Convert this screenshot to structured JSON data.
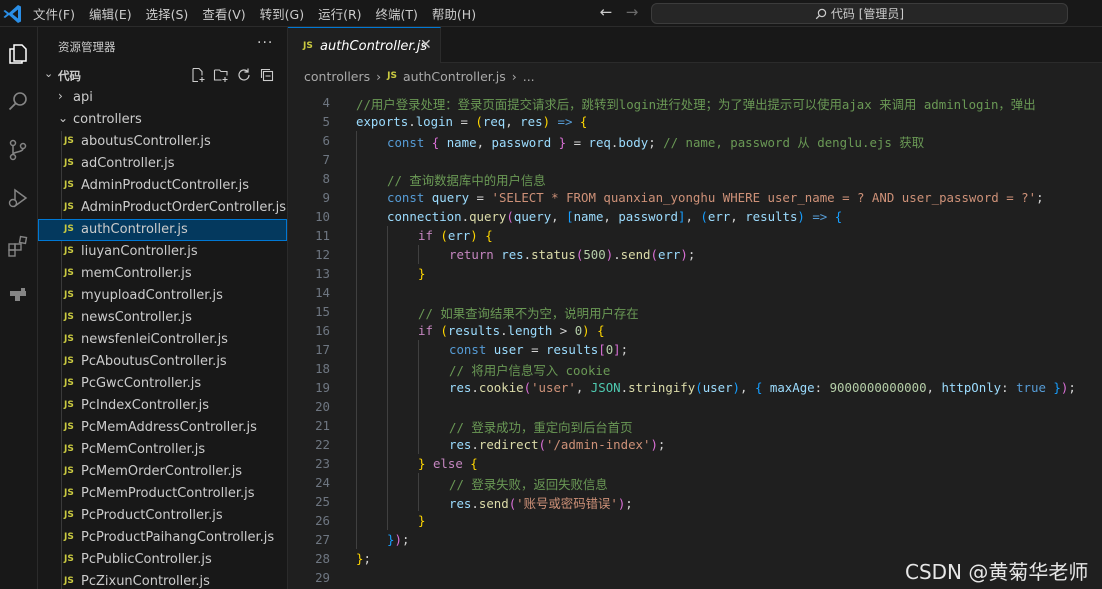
{
  "menu": [
    "文件(F)",
    "编辑(E)",
    "选择(S)",
    "查看(V)",
    "转到(G)",
    "运行(R)",
    "终端(T)",
    "帮助(H)"
  ],
  "search_label": "代码 [管理员]",
  "explorer": {
    "title": "资源管理器",
    "more": "···",
    "root": "代码",
    "items": [
      {
        "label": "api",
        "type": "folder",
        "expanded": false,
        "depth": 1
      },
      {
        "label": "controllers",
        "type": "folder",
        "expanded": true,
        "depth": 1
      },
      {
        "label": "aboutusController.js",
        "type": "js",
        "depth": 2
      },
      {
        "label": "adController.js",
        "type": "js",
        "depth": 2
      },
      {
        "label": "AdminProductController.js",
        "type": "js",
        "depth": 2
      },
      {
        "label": "AdminProductOrderController.js",
        "type": "js",
        "depth": 2
      },
      {
        "label": "authController.js",
        "type": "js",
        "depth": 2,
        "selected": true
      },
      {
        "label": "liuyanController.js",
        "type": "js",
        "depth": 2
      },
      {
        "label": "memController.js",
        "type": "js",
        "depth": 2
      },
      {
        "label": "myuploadController.js",
        "type": "js",
        "depth": 2
      },
      {
        "label": "newsController.js",
        "type": "js",
        "depth": 2
      },
      {
        "label": "newsfenleiController.js",
        "type": "js",
        "depth": 2
      },
      {
        "label": "PcAboutusController.js",
        "type": "js",
        "depth": 2
      },
      {
        "label": "PcGwcController.js",
        "type": "js",
        "depth": 2
      },
      {
        "label": "PcIndexController.js",
        "type": "js",
        "depth": 2
      },
      {
        "label": "PcMemAddressController.js",
        "type": "js",
        "depth": 2
      },
      {
        "label": "PcMemController.js",
        "type": "js",
        "depth": 2
      },
      {
        "label": "PcMemOrderController.js",
        "type": "js",
        "depth": 2
      },
      {
        "label": "PcMemProductController.js",
        "type": "js",
        "depth": 2
      },
      {
        "label": "PcProductController.js",
        "type": "js",
        "depth": 2
      },
      {
        "label": "PcProductPaihangController.js",
        "type": "js",
        "depth": 2
      },
      {
        "label": "PcPublicController.js",
        "type": "js",
        "depth": 2
      },
      {
        "label": "PcZixunController.js",
        "type": "js",
        "depth": 2
      }
    ]
  },
  "tab": {
    "label": "authController.js",
    "icon": "JS"
  },
  "breadcrumb": [
    "controllers",
    "authController.js",
    "..."
  ],
  "code": [
    {
      "n": "4",
      "indent": 0,
      "t": [
        [
          "c",
          "//用户登录处理：登录页面提交请求后，跳转到login进行处理；为了弹出提示可以使用ajax 来调用 adminlogin，弹出"
        ]
      ]
    },
    {
      "n": "5",
      "indent": 0,
      "t": [
        [
          "v",
          "exports"
        ],
        [
          "p",
          "."
        ],
        [
          "v",
          "login"
        ],
        [
          "p",
          " = "
        ],
        [
          "b1",
          "("
        ],
        [
          "v",
          "req"
        ],
        [
          "p",
          ", "
        ],
        [
          "v",
          "res"
        ],
        [
          "b1",
          ")"
        ],
        [
          "p",
          " "
        ],
        [
          "k",
          "=>"
        ],
        [
          "p",
          " "
        ],
        [
          "b1",
          "{"
        ]
      ]
    },
    {
      "n": "6",
      "indent": 1,
      "t": [
        [
          "k",
          "const"
        ],
        [
          "p",
          " "
        ],
        [
          "b2",
          "{"
        ],
        [
          "p",
          " "
        ],
        [
          "v",
          "name"
        ],
        [
          "p",
          ", "
        ],
        [
          "v",
          "password"
        ],
        [
          "p",
          " "
        ],
        [
          "b2",
          "}"
        ],
        [
          "p",
          " = "
        ],
        [
          "v",
          "req"
        ],
        [
          "p",
          "."
        ],
        [
          "v",
          "body"
        ],
        [
          "p",
          "; "
        ],
        [
          "c",
          "// name, password 从 denglu.ejs 获取"
        ]
      ]
    },
    {
      "n": "7",
      "indent": 1,
      "t": []
    },
    {
      "n": "8",
      "indent": 1,
      "t": [
        [
          "c",
          "// 查询数据库中的用户信息"
        ]
      ]
    },
    {
      "n": "9",
      "indent": 1,
      "t": [
        [
          "k",
          "const"
        ],
        [
          "p",
          " "
        ],
        [
          "v",
          "query"
        ],
        [
          "p",
          " = "
        ],
        [
          "s",
          "'SELECT * FROM quanxian_yonghu WHERE user_name = ? AND user_password = ?'"
        ],
        [
          "p",
          ";"
        ]
      ]
    },
    {
      "n": "10",
      "indent": 1,
      "t": [
        [
          "v",
          "connection"
        ],
        [
          "p",
          "."
        ],
        [
          "f",
          "query"
        ],
        [
          "b2",
          "("
        ],
        [
          "v",
          "query"
        ],
        [
          "p",
          ", "
        ],
        [
          "b3",
          "["
        ],
        [
          "v",
          "name"
        ],
        [
          "p",
          ", "
        ],
        [
          "v",
          "password"
        ],
        [
          "b3",
          "]"
        ],
        [
          "p",
          ", "
        ],
        [
          "b3",
          "("
        ],
        [
          "v",
          "err"
        ],
        [
          "p",
          ", "
        ],
        [
          "v",
          "results"
        ],
        [
          "b3",
          ")"
        ],
        [
          "p",
          " "
        ],
        [
          "k",
          "=>"
        ],
        [
          "p",
          " "
        ],
        [
          "b3",
          "{"
        ]
      ]
    },
    {
      "n": "11",
      "indent": 2,
      "t": [
        [
          "kf",
          "if"
        ],
        [
          "p",
          " "
        ],
        [
          "b1",
          "("
        ],
        [
          "v",
          "err"
        ],
        [
          "b1",
          ")"
        ],
        [
          "p",
          " "
        ],
        [
          "b1",
          "{"
        ]
      ]
    },
    {
      "n": "12",
      "indent": 3,
      "t": [
        [
          "kf",
          "return"
        ],
        [
          "p",
          " "
        ],
        [
          "v",
          "res"
        ],
        [
          "p",
          "."
        ],
        [
          "f",
          "status"
        ],
        [
          "b2",
          "("
        ],
        [
          "n",
          "500"
        ],
        [
          "b2",
          ")"
        ],
        [
          "p",
          "."
        ],
        [
          "f",
          "send"
        ],
        [
          "b2",
          "("
        ],
        [
          "v",
          "err"
        ],
        [
          "b2",
          ")"
        ],
        [
          "p",
          ";"
        ]
      ]
    },
    {
      "n": "13",
      "indent": 2,
      "t": [
        [
          "b1",
          "}"
        ]
      ]
    },
    {
      "n": "14",
      "indent": 2,
      "t": []
    },
    {
      "n": "15",
      "indent": 2,
      "t": [
        [
          "c",
          "// 如果查询结果不为空，说明用户存在"
        ]
      ]
    },
    {
      "n": "16",
      "indent": 2,
      "t": [
        [
          "kf",
          "if"
        ],
        [
          "p",
          " "
        ],
        [
          "b1",
          "("
        ],
        [
          "v",
          "results"
        ],
        [
          "p",
          "."
        ],
        [
          "v",
          "length"
        ],
        [
          "p",
          " > "
        ],
        [
          "n",
          "0"
        ],
        [
          "b1",
          ")"
        ],
        [
          "p",
          " "
        ],
        [
          "b1",
          "{"
        ]
      ]
    },
    {
      "n": "17",
      "indent": 3,
      "t": [
        [
          "k",
          "const"
        ],
        [
          "p",
          " "
        ],
        [
          "v",
          "user"
        ],
        [
          "p",
          " = "
        ],
        [
          "v",
          "results"
        ],
        [
          "b2",
          "["
        ],
        [
          "n",
          "0"
        ],
        [
          "b2",
          "]"
        ],
        [
          "p",
          ";"
        ]
      ]
    },
    {
      "n": "18",
      "indent": 3,
      "t": [
        [
          "c",
          "// 将用户信息写入 cookie"
        ]
      ]
    },
    {
      "n": "19",
      "indent": 3,
      "t": [
        [
          "v",
          "res"
        ],
        [
          "p",
          "."
        ],
        [
          "f",
          "cookie"
        ],
        [
          "b2",
          "("
        ],
        [
          "s",
          "'user'"
        ],
        [
          "p",
          ", "
        ],
        [
          "cl",
          "JSON"
        ],
        [
          "p",
          "."
        ],
        [
          "f",
          "stringify"
        ],
        [
          "b3",
          "("
        ],
        [
          "v",
          "user"
        ],
        [
          "b3",
          ")"
        ],
        [
          "p",
          ", "
        ],
        [
          "b3",
          "{"
        ],
        [
          "p",
          " "
        ],
        [
          "v",
          "maxAge"
        ],
        [
          "p",
          ": "
        ],
        [
          "n",
          "9000000000000"
        ],
        [
          "p",
          ", "
        ],
        [
          "v",
          "httpOnly"
        ],
        [
          "p",
          ": "
        ],
        [
          "k",
          "true"
        ],
        [
          "p",
          " "
        ],
        [
          "b3",
          "}"
        ],
        [
          "b2",
          ")"
        ],
        [
          "p",
          ";"
        ]
      ]
    },
    {
      "n": "20",
      "indent": 3,
      "t": []
    },
    {
      "n": "21",
      "indent": 3,
      "t": [
        [
          "c",
          "// 登录成功，重定向到后台首页"
        ]
      ]
    },
    {
      "n": "22",
      "indent": 3,
      "t": [
        [
          "v",
          "res"
        ],
        [
          "p",
          "."
        ],
        [
          "f",
          "redirect"
        ],
        [
          "b2",
          "("
        ],
        [
          "s",
          "'/admin-index'"
        ],
        [
          "b2",
          ")"
        ],
        [
          "p",
          ";"
        ]
      ]
    },
    {
      "n": "23",
      "indent": 2,
      "t": [
        [
          "b1",
          "}"
        ],
        [
          "p",
          " "
        ],
        [
          "kf",
          "else"
        ],
        [
          "p",
          " "
        ],
        [
          "b1",
          "{"
        ]
      ]
    },
    {
      "n": "24",
      "indent": 3,
      "t": [
        [
          "c",
          "// 登录失败，返回失败信息"
        ]
      ]
    },
    {
      "n": "25",
      "indent": 3,
      "t": [
        [
          "v",
          "res"
        ],
        [
          "p",
          "."
        ],
        [
          "f",
          "send"
        ],
        [
          "b2",
          "("
        ],
        [
          "s",
          "'账号或密码错误'"
        ],
        [
          "b2",
          ")"
        ],
        [
          "p",
          ";"
        ]
      ]
    },
    {
      "n": "26",
      "indent": 2,
      "t": [
        [
          "b1",
          "}"
        ]
      ]
    },
    {
      "n": "27",
      "indent": 1,
      "t": [
        [
          "b3",
          "}"
        ],
        [
          "b2",
          ")"
        ],
        [
          "p",
          ";"
        ]
      ]
    },
    {
      "n": "28",
      "indent": 0,
      "t": [
        [
          "b1",
          "}"
        ],
        [
          "p",
          ";"
        ]
      ]
    },
    {
      "n": "29",
      "indent": 0,
      "t": []
    }
  ],
  "watermark": "CSDN @黄菊华老师",
  "colors": {
    "accent": "#0078d4",
    "js_icon": "#cbcb41",
    "selection": "#04395e"
  }
}
